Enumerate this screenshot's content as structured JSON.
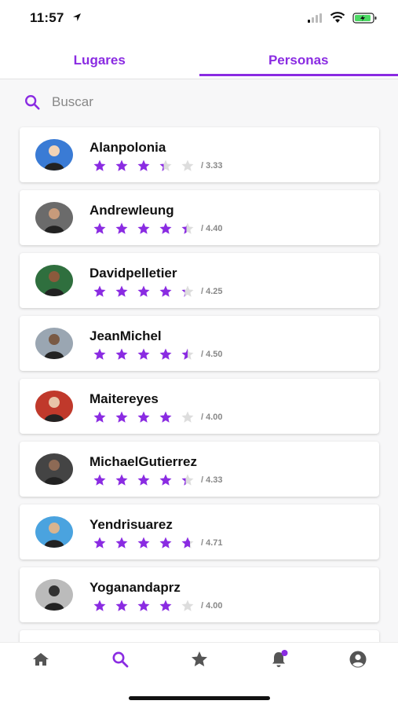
{
  "status_bar": {
    "time": "11:57"
  },
  "tabs": [
    {
      "label": "Lugares",
      "active": false
    },
    {
      "label": "Personas",
      "active": true
    }
  ],
  "search": {
    "placeholder": "Buscar"
  },
  "colors": {
    "accent": "#8a2be2",
    "star_empty": "#dddddd"
  },
  "people": [
    {
      "name": "Alanpolonia",
      "rating_text": "/ 3.33",
      "rating": 3.33
    },
    {
      "name": "Andrewleung",
      "rating_text": "/ 4.40",
      "rating": 4.4
    },
    {
      "name": "Davidpelletier",
      "rating_text": "/ 4.25",
      "rating": 4.25
    },
    {
      "name": "JeanMichel",
      "rating_text": "/ 4.50",
      "rating": 4.5
    },
    {
      "name": "Maitereyes",
      "rating_text": "/ 4.00",
      "rating": 4.0
    },
    {
      "name": "MichaelGutierrez",
      "rating_text": "/ 4.33",
      "rating": 4.33
    },
    {
      "name": "Yendrisuarez",
      "rating_text": "/ 4.71",
      "rating": 4.71
    },
    {
      "name": "Yoganandaprz",
      "rating_text": "/ 4.00",
      "rating": 4.0
    }
  ],
  "bottom_nav": [
    {
      "icon": "home-icon",
      "active": false
    },
    {
      "icon": "search-icon",
      "active": true
    },
    {
      "icon": "star-icon",
      "active": false
    },
    {
      "icon": "bell-icon",
      "active": false,
      "badge": true
    },
    {
      "icon": "account-icon",
      "active": false
    }
  ]
}
